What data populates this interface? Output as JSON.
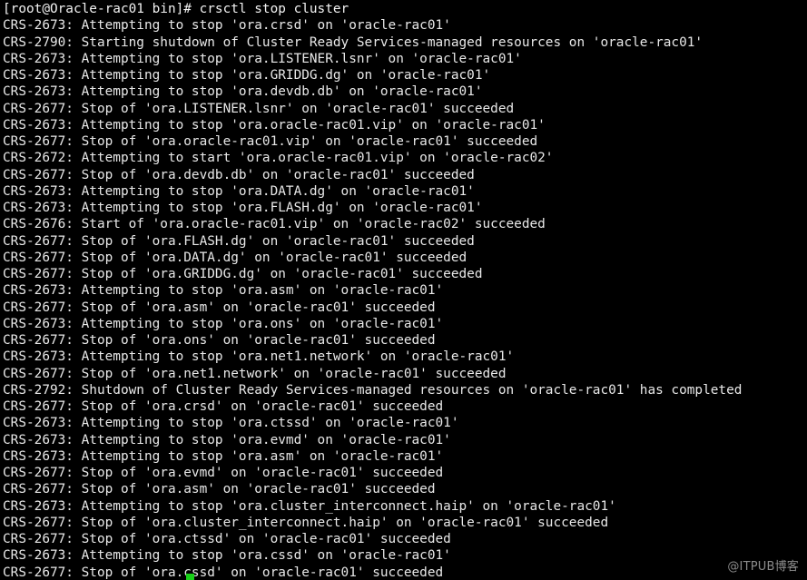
{
  "terminal": {
    "title": "crsctl stop cluster",
    "background_color": "#000000",
    "foreground_color": "#e8e8e8",
    "cursor_color": "#18d118",
    "columns": 98,
    "rows": 35,
    "prompt": "[root@Oracle-rac01 bin]#",
    "command": "crsctl stop cluster",
    "prompt_line": "[root@Oracle-rac01 bin]# crsctl stop cluster",
    "lines": [
      "[root@Oracle-rac01 bin]# crsctl stop cluster",
      "CRS-2673: Attempting to stop 'ora.crsd' on 'oracle-rac01'",
      "CRS-2790: Starting shutdown of Cluster Ready Services-managed resources on 'oracle-rac01'",
      "CRS-2673: Attempting to stop 'ora.LISTENER.lsnr' on 'oracle-rac01'",
      "CRS-2673: Attempting to stop 'ora.GRIDDG.dg' on 'oracle-rac01'",
      "CRS-2673: Attempting to stop 'ora.devdb.db' on 'oracle-rac01'",
      "CRS-2677: Stop of 'ora.LISTENER.lsnr' on 'oracle-rac01' succeeded",
      "CRS-2673: Attempting to stop 'ora.oracle-rac01.vip' on 'oracle-rac01'",
      "CRS-2677: Stop of 'ora.oracle-rac01.vip' on 'oracle-rac01' succeeded",
      "CRS-2672: Attempting to start 'ora.oracle-rac01.vip' on 'oracle-rac02'",
      "CRS-2677: Stop of 'ora.devdb.db' on 'oracle-rac01' succeeded",
      "CRS-2673: Attempting to stop 'ora.DATA.dg' on 'oracle-rac01'",
      "CRS-2673: Attempting to stop 'ora.FLASH.dg' on 'oracle-rac01'",
      "CRS-2676: Start of 'ora.oracle-rac01.vip' on 'oracle-rac02' succeeded",
      "CRS-2677: Stop of 'ora.FLASH.dg' on 'oracle-rac01' succeeded",
      "CRS-2677: Stop of 'ora.DATA.dg' on 'oracle-rac01' succeeded",
      "CRS-2677: Stop of 'ora.GRIDDG.dg' on 'oracle-rac01' succeeded",
      "CRS-2673: Attempting to stop 'ora.asm' on 'oracle-rac01'",
      "CRS-2677: Stop of 'ora.asm' on 'oracle-rac01' succeeded",
      "CRS-2673: Attempting to stop 'ora.ons' on 'oracle-rac01'",
      "CRS-2677: Stop of 'ora.ons' on 'oracle-rac01' succeeded",
      "CRS-2673: Attempting to stop 'ora.net1.network' on 'oracle-rac01'",
      "CRS-2677: Stop of 'ora.net1.network' on 'oracle-rac01' succeeded",
      "CRS-2792: Shutdown of Cluster Ready Services-managed resources on 'oracle-rac01' has completed",
      "CRS-2677: Stop of 'ora.crsd' on 'oracle-rac01' succeeded",
      "CRS-2673: Attempting to stop 'ora.ctssd' on 'oracle-rac01'",
      "CRS-2673: Attempting to stop 'ora.evmd' on 'oracle-rac01'",
      "CRS-2673: Attempting to stop 'ora.asm' on 'oracle-rac01'",
      "CRS-2677: Stop of 'ora.evmd' on 'oracle-rac01' succeeded",
      "CRS-2677: Stop of 'ora.asm' on 'oracle-rac01' succeeded",
      "CRS-2673: Attempting to stop 'ora.cluster_interconnect.haip' on 'oracle-rac01'",
      "CRS-2677: Stop of 'ora.cluster_interconnect.haip' on 'oracle-rac01' succeeded",
      "CRS-2677: Stop of 'ora.ctssd' on 'oracle-rac01' succeeded",
      "CRS-2673: Attempting to stop 'ora.cssd' on 'oracle-rac01'",
      "CRS-2677: Stop of 'ora.cssd' on 'oracle-rac01' succeeded"
    ]
  },
  "watermark": {
    "text": "@ITPUB博客",
    "color": "#8c8c8c"
  }
}
